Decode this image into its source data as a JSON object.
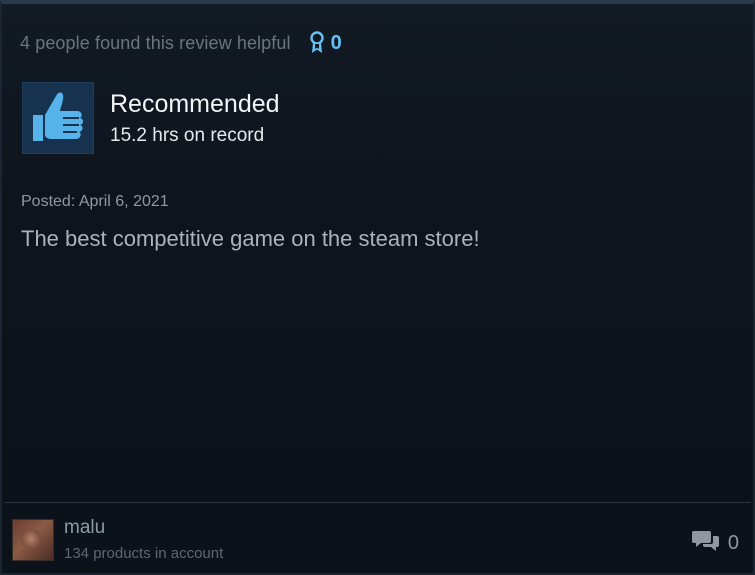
{
  "review": {
    "helpful_text": "4 people found this review helpful",
    "award_count": "0",
    "verdict": "Recommended",
    "hours": "15.2 hrs on record",
    "posted": "Posted: April 6, 2021",
    "text": "The best competitive game on the steam store!"
  },
  "author": {
    "name": "malu",
    "products": "134 products in account"
  },
  "footer": {
    "comment_count": "0"
  },
  "icons": {
    "award": "award-ribbon-icon",
    "thumb": "thumbs-up-icon",
    "comments": "comments-icon"
  },
  "colors": {
    "accent": "#66c0f4",
    "background": "#0f141c",
    "thumb_box": "#16324f"
  }
}
